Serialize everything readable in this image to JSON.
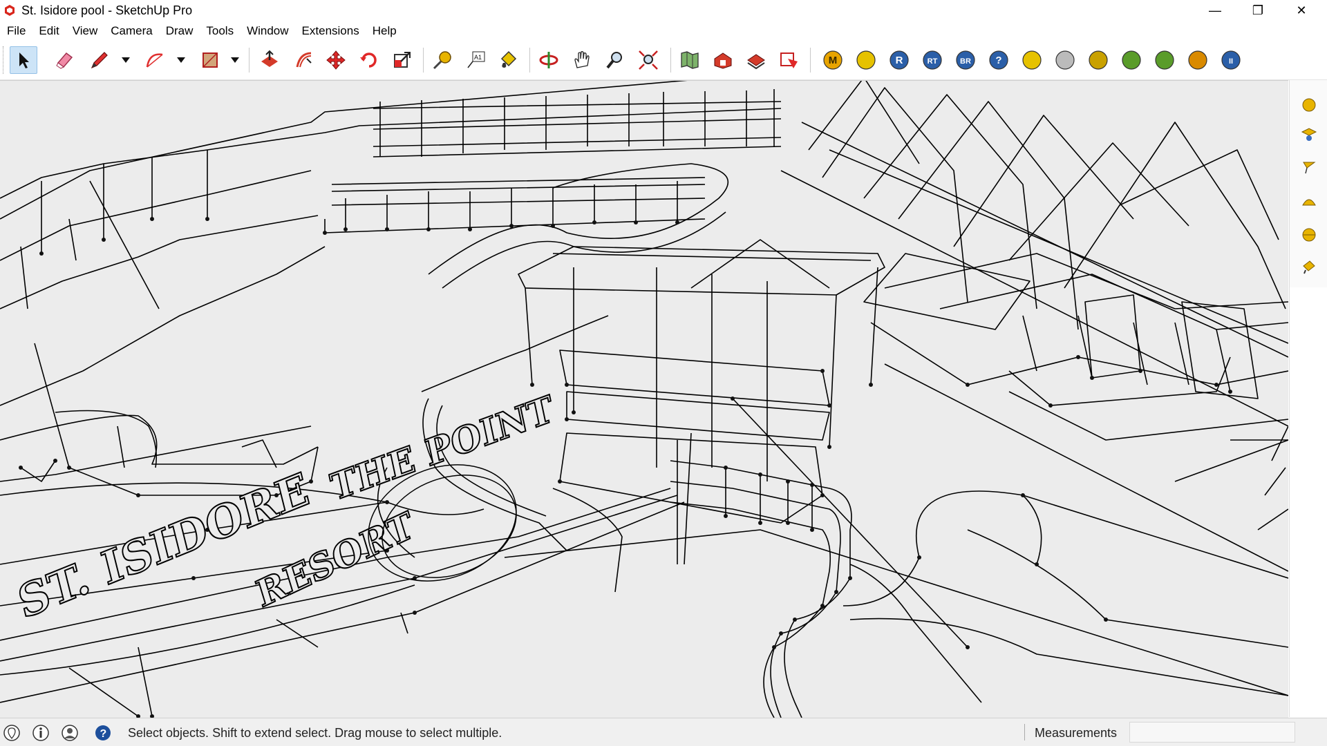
{
  "window": {
    "title": "St. Isidore pool - SketchUp Pro",
    "controls": {
      "minimize": "—",
      "maximize": "❐",
      "close": "✕"
    }
  },
  "menu": [
    "File",
    "Edit",
    "View",
    "Camera",
    "Draw",
    "Tools",
    "Window",
    "Extensions",
    "Help"
  ],
  "toolbar": {
    "tools": [
      {
        "name": "select-tool",
        "icon": "arrow-cursor-icon",
        "active": true
      },
      {
        "name": "eraser-tool",
        "icon": "eraser-icon"
      },
      {
        "name": "line-tool",
        "icon": "pencil-icon"
      },
      {
        "name": "arc-tool",
        "icon": "arc-icon"
      },
      {
        "name": "shape-tool",
        "icon": "rectangle-icon"
      },
      {
        "name": "push-pull-tool",
        "icon": "push-pull-icon"
      },
      {
        "name": "offset-tool",
        "icon": "offset-icon"
      },
      {
        "name": "move-tool",
        "icon": "move-icon"
      },
      {
        "name": "rotate-tool",
        "icon": "rotate-icon"
      },
      {
        "name": "scale-tool",
        "icon": "scale-icon"
      },
      {
        "name": "tape-measure-tool",
        "icon": "tape-measure-icon"
      },
      {
        "name": "text-tool",
        "icon": "text-icon"
      },
      {
        "name": "paint-bucket-tool",
        "icon": "paint-bucket-icon"
      },
      {
        "name": "orbit-tool",
        "icon": "orbit-icon"
      },
      {
        "name": "pan-tool",
        "icon": "hand-icon"
      },
      {
        "name": "zoom-tool",
        "icon": "magnifier-icon"
      },
      {
        "name": "zoom-extents-tool",
        "icon": "zoom-extents-icon"
      },
      {
        "name": "add-location-tool",
        "icon": "map-icon"
      },
      {
        "name": "3d-warehouse-tool",
        "icon": "warehouse-icon"
      },
      {
        "name": "extension-warehouse-tool",
        "icon": "extension-warehouse-icon"
      },
      {
        "name": "layout-tool",
        "icon": "layout-icon"
      }
    ],
    "plugin_buttons": [
      {
        "label": "M",
        "color": "#e8a400"
      },
      {
        "label": "",
        "color": "#e6c200",
        "icon": "tag-icon"
      },
      {
        "label": "R",
        "color": "#2b5fa8"
      },
      {
        "label": "RT",
        "color": "#2b5fa8"
      },
      {
        "label": "BR",
        "color": "#2b5fa8"
      },
      {
        "label": "?",
        "color": "#2b5fa8"
      },
      {
        "label": "",
        "color": "#e6c200",
        "icon": "tag-alt-icon"
      },
      {
        "label": "",
        "color": "#bbbbbb",
        "icon": "sphere-icon"
      },
      {
        "label": "",
        "color": "#c9a100",
        "icon": "stack-icon"
      },
      {
        "label": "",
        "color": "#5a9c2a",
        "icon": "tree-icon"
      },
      {
        "label": "",
        "color": "#5a9c2a",
        "icon": "tree-alt-icon"
      },
      {
        "label": "",
        "color": "#d98a00",
        "icon": "target-icon"
      },
      {
        "label": "II",
        "color": "#2b5fa8"
      }
    ]
  },
  "viewport": {
    "model_text": [
      "ST. ISIDORE",
      "THE POINT",
      "RESORT"
    ]
  },
  "status": {
    "message": "Select objects. Shift to extend select. Drag mouse to select multiple.",
    "measurements_label": "Measurements",
    "measurements_value": ""
  }
}
